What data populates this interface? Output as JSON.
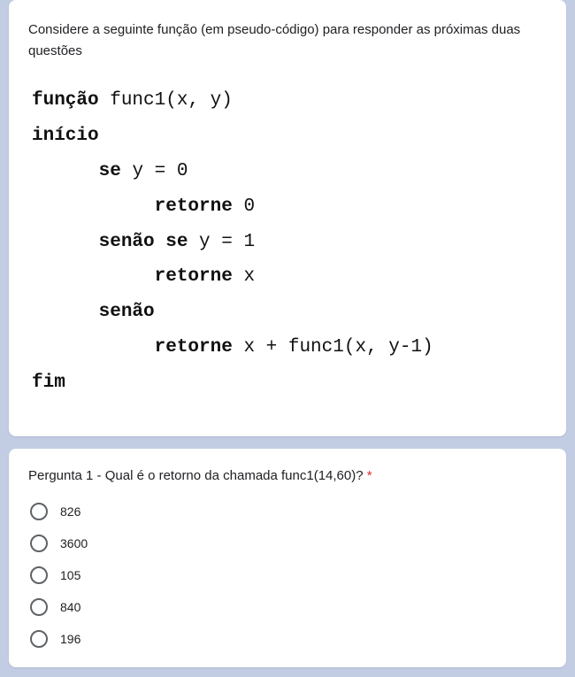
{
  "intro": {
    "text": "Considere a seguinte função (em pseudo-código) para responder as próximas duas questões"
  },
  "code": {
    "l1_kw": "função",
    "l1_rest": " func1(x, y)",
    "l2_kw": "início",
    "l3_kw": "se",
    "l3_rest": " y = 0",
    "l4_kw": "retorne",
    "l4_rest": " 0",
    "l5_kw": "senão se",
    "l5_rest": " y = 1",
    "l6_kw": "retorne",
    "l6_rest": " x",
    "l7_kw": "senão",
    "l8_kw": "retorne",
    "l8_rest": " x + func1(x, y-1)",
    "l9_kw": "fim"
  },
  "question": {
    "text": "Pergunta 1 - Qual é o retorno da chamada func1(14,60)? ",
    "required_mark": "*",
    "options": [
      {
        "label": "826"
      },
      {
        "label": "3600"
      },
      {
        "label": "105"
      },
      {
        "label": "840"
      },
      {
        "label": "196"
      }
    ]
  }
}
